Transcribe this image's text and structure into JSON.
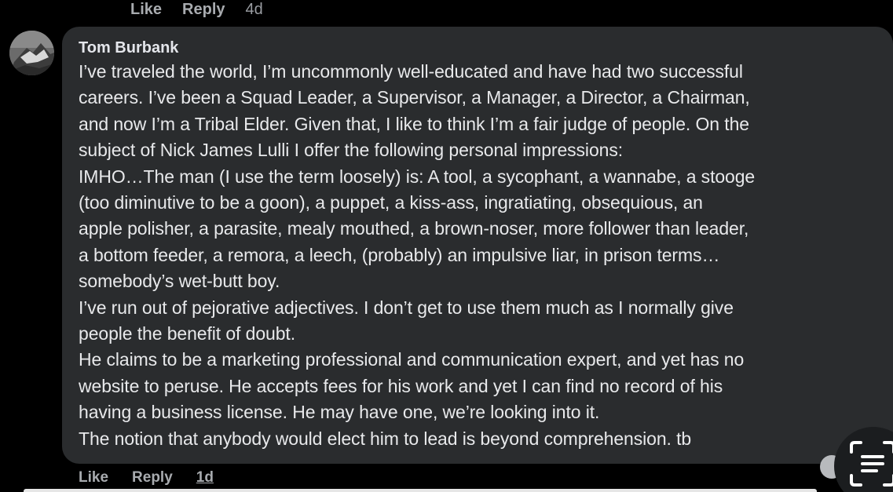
{
  "top_actions": {
    "like": "Like",
    "reply": "Reply",
    "time": "4d"
  },
  "comment": {
    "author": "Tom Burbank",
    "lines": [
      "I’ve traveled the world, I’m uncommonly well-educated and have had two successful",
      "careers. I’ve been a Squad Leader, a Supervisor, a Manager, a Director, a Chairman,",
      "and now I’m a Tribal Elder. Given that, I like to think I’m a fair judge of people. On the",
      "subject of Nick James Lulli I offer the following personal impressions:",
      "IMHO…The man (I use the term loosely) is:  A tool, a sycophant, a wannabe, a stooge",
      "(too diminutive to be a goon), a puppet, a kiss-ass, ingratiating, obsequious, an",
      "apple polisher, a parasite, mealy mouthed, a brown-noser, more follower than leader,",
      "a bottom feeder, a remora, a leech, (probably) an impulsive liar, in prison terms…",
      "somebody’s wet-butt boy.",
      "I’ve run out of pejorative adjectives. I don’t get to use them much as I normally give",
      "people the benefit of doubt.",
      "He claims to be a marketing professional and communication expert, and yet has no",
      "website to peruse. He accepts fees for his work and yet I can find no record of his",
      "having a business license. He may have one, we’re looking into it.",
      "The notion that anybody would elect him to lead is beyond comprehension. tb"
    ]
  },
  "bottom_actions": {
    "like": "Like",
    "reply": "Reply",
    "time": "1d"
  },
  "icons": {
    "fab": "text-scan-icon",
    "avatar": "profile-photo"
  },
  "colors": {
    "background": "#000000",
    "bubble": "#2a2c2e",
    "text": "#e4e6eb",
    "muted": "#a8abaf"
  }
}
